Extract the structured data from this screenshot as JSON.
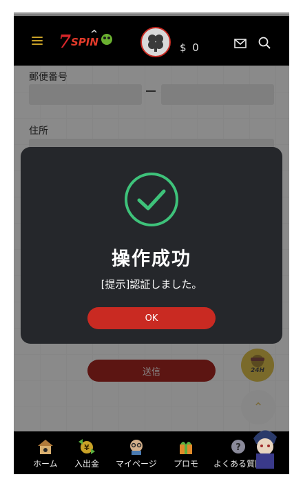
{
  "header": {
    "logo_text": "7SPINS",
    "balance": "$ 0",
    "menu_icon": "hamburger-icon",
    "mail_icon": "mail-icon",
    "search_icon": "search-icon"
  },
  "form": {
    "postal_label": "郵便番号",
    "postal_separator": "–",
    "address_label": "住所",
    "submit_label": "送信"
  },
  "chat_badge": "24H",
  "dialog": {
    "title": "操作成功",
    "message": "[提示]認証しました。",
    "ok_label": "OK",
    "icon": "check-circle-icon",
    "accent": "#3ec27a"
  },
  "bottom_nav": {
    "items": [
      {
        "label": "ホーム",
        "icon": "home-icon"
      },
      {
        "label": "入出金",
        "icon": "deposit-withdraw-icon"
      },
      {
        "label": "マイページ",
        "icon": "mypage-icon"
      },
      {
        "label": "プロモ",
        "icon": "gift-icon"
      },
      {
        "label": "よくある質問",
        "icon": "faq-icon"
      }
    ]
  },
  "colors": {
    "brand_red": "#c92a22",
    "header_bg": "#000000",
    "dialog_bg": "#25272b",
    "gold": "#c9a227"
  }
}
